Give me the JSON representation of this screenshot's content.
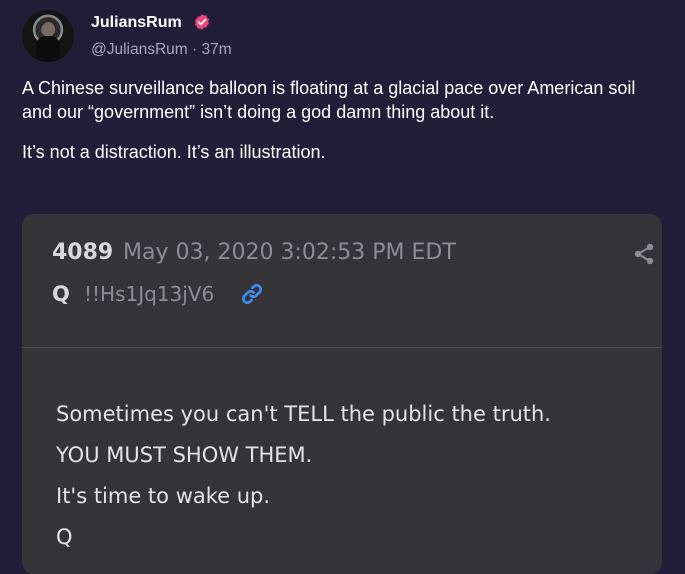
{
  "author": {
    "display_name": "JuliansRum",
    "handle": "@JuliansRum",
    "separator": "·",
    "time_ago": "37m",
    "avatar_icon": "profile-photo",
    "badge_icon": "verified-badge-icon",
    "badge_color": "#f0457a"
  },
  "post": {
    "paragraphs": [
      "A Chinese surveillance balloon is floating at a glacial pace over American soil and our “government” isn’t doing a god damn thing about it.",
      "It’s not a distraction. It’s an illustration."
    ]
  },
  "quote": {
    "number": "4089",
    "date": "May 03, 2020 3:02:53 PM EDT",
    "signature": "Q",
    "tripcode": "!!Hs1Jq13jV6",
    "share_icon": "share-icon",
    "link_icon": "link-icon",
    "link_color": "#3d8ff5",
    "body_lines": [
      "Sometimes you can't TELL the public the truth.",
      "YOU MUST SHOW THEM.",
      "It's time to wake up.",
      "Q"
    ]
  },
  "colors": {
    "background": "#221d38",
    "card": "#353439",
    "secondary_text": "#a8a3c1"
  }
}
